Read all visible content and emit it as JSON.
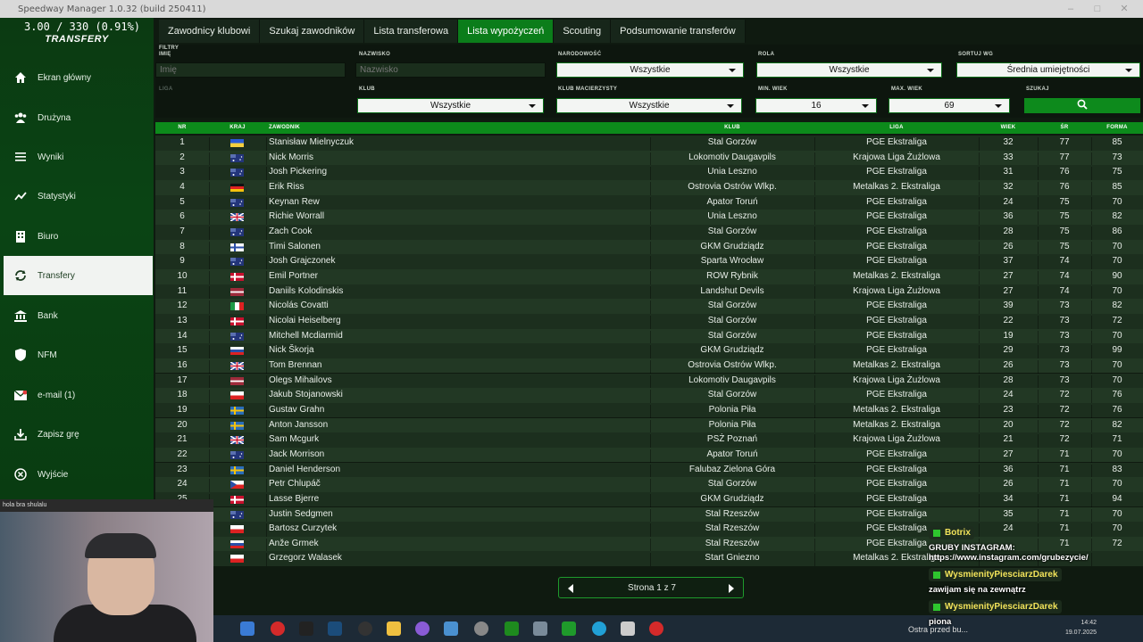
{
  "window": {
    "title": "Speedway Manager 1.0.32 (build 250411)"
  },
  "sidebar": {
    "budget": "3.00 / 330 (0.91%)",
    "section": "TRANSFERY",
    "items": [
      {
        "label": "Ekran główny",
        "icon": "home-icon"
      },
      {
        "label": "Drużyna",
        "icon": "team-icon"
      },
      {
        "label": "Wyniki",
        "icon": "list-icon"
      },
      {
        "label": "Statystyki",
        "icon": "stats-icon"
      },
      {
        "label": "Biuro",
        "icon": "office-icon"
      },
      {
        "label": "Transfery",
        "icon": "transfer-icon"
      },
      {
        "label": "Bank",
        "icon": "bank-icon"
      },
      {
        "label": "NFM",
        "icon": "shield-icon"
      },
      {
        "label": "e-mail (1)",
        "icon": "mail-icon"
      },
      {
        "label": "Zapisz grę",
        "icon": "save-icon"
      },
      {
        "label": "Wyjście",
        "icon": "exit-icon"
      }
    ],
    "active_index": 5
  },
  "tabs": [
    "Zawodnicy klubowi",
    "Szukaj zawodników",
    "Lista transferowa",
    "Lista wypożyczeń",
    "Scouting",
    "Podsumowanie transferów"
  ],
  "active_tab": 3,
  "filters": {
    "heading": "FILTRY",
    "name_label": "IMIĘ",
    "name_placeholder": "Imię",
    "surname_label": "NAZWISKO",
    "surname_placeholder": "Nazwisko",
    "nationality_label": "NARODOWOŚĆ",
    "nationality_value": "Wszystkie",
    "role_label": "ROLA",
    "role_value": "Wszystkie",
    "sort_label": "SORTUJ WG",
    "sort_value": "Średnia umiejętności",
    "league_label": "LIGA",
    "club_label": "KLUB",
    "club_value": "Wszystkie",
    "parent_club_label": "KLUB MACIERZYSTY",
    "parent_club_value": "Wszystkie",
    "min_age_label": "MIN. WIEK",
    "min_age_value": "16",
    "max_age_label": "MAX. WIEK",
    "max_age_value": "69",
    "search_label": "SZUKAJ"
  },
  "table": {
    "headers": {
      "nr": "NR",
      "kraj": "KRAJ",
      "zawodnik": "ZAWODNIK",
      "klub": "KLUB",
      "liga": "LIGA",
      "wiek": "WIEK",
      "sr": "ŚR",
      "forma": "FORMA"
    },
    "rows": [
      {
        "nr": "1",
        "flag": "ua",
        "name": "Stanisław Mielnyczuk",
        "club": "Stal Gorzów",
        "league": "PGE Ekstraliga",
        "age": "32",
        "avg": "77",
        "form": "85"
      },
      {
        "nr": "2",
        "flag": "au",
        "name": "Nick Morris",
        "club": "Lokomotiv Daugavpils",
        "league": "Krajowa Liga Żużlowa",
        "age": "33",
        "avg": "77",
        "form": "73"
      },
      {
        "nr": "3",
        "flag": "au",
        "name": "Josh Pickering",
        "club": "Unia Leszno",
        "league": "PGE Ekstraliga",
        "age": "31",
        "avg": "76",
        "form": "75"
      },
      {
        "nr": "4",
        "flag": "de",
        "name": "Erik Riss",
        "club": "Ostrovia Ostrów Wlkp.",
        "league": "Metalkas 2. Ekstraliga",
        "age": "32",
        "avg": "76",
        "form": "85"
      },
      {
        "nr": "5",
        "flag": "au",
        "name": "Keynan Rew",
        "club": "Apator Toruń",
        "league": "PGE Ekstraliga",
        "age": "24",
        "avg": "75",
        "form": "70"
      },
      {
        "nr": "6",
        "flag": "gb",
        "name": "Richie Worrall",
        "club": "Unia Leszno",
        "league": "PGE Ekstraliga",
        "age": "36",
        "avg": "75",
        "form": "82"
      },
      {
        "nr": "7",
        "flag": "au",
        "name": "Zach Cook",
        "club": "Stal Gorzów",
        "league": "PGE Ekstraliga",
        "age": "28",
        "avg": "75",
        "form": "86"
      },
      {
        "nr": "8",
        "flag": "fi",
        "name": "Timi Salonen",
        "club": "GKM Grudziądz",
        "league": "PGE Ekstraliga",
        "age": "26",
        "avg": "75",
        "form": "70"
      },
      {
        "nr": "9",
        "flag": "au",
        "name": "Josh Grajczonek",
        "club": "Sparta Wrocław",
        "league": "PGE Ekstraliga",
        "age": "37",
        "avg": "74",
        "form": "70"
      },
      {
        "nr": "10",
        "flag": "dk",
        "name": "Emil Portner",
        "club": "ROW Rybnik",
        "league": "Metalkas 2. Ekstraliga",
        "age": "27",
        "avg": "74",
        "form": "90"
      },
      {
        "nr": "11",
        "flag": "lv",
        "name": "Daniils Kolodinskis",
        "club": "Landshut Devils",
        "league": "Krajowa Liga Żużlowa",
        "age": "27",
        "avg": "74",
        "form": "70"
      },
      {
        "nr": "12",
        "flag": "it",
        "name": "Nicolás Covatti",
        "club": "Stal Gorzów",
        "league": "PGE Ekstraliga",
        "age": "39",
        "avg": "73",
        "form": "82"
      },
      {
        "nr": "13",
        "flag": "dk",
        "name": "Nicolai Heiselberg",
        "club": "Stal Gorzów",
        "league": "PGE Ekstraliga",
        "age": "22",
        "avg": "73",
        "form": "72"
      },
      {
        "nr": "14",
        "flag": "au",
        "name": "Mitchell Mcdiarmid",
        "club": "Stal Gorzów",
        "league": "PGE Ekstraliga",
        "age": "19",
        "avg": "73",
        "form": "70"
      },
      {
        "nr": "15",
        "flag": "si",
        "name": "Nick Škorja",
        "club": "GKM Grudziądz",
        "league": "PGE Ekstraliga",
        "age": "29",
        "avg": "73",
        "form": "99"
      },
      {
        "nr": "16",
        "flag": "gb",
        "name": "Tom Brennan",
        "club": "Ostrovia Ostrów Wlkp.",
        "league": "Metalkas 2. Ekstraliga",
        "age": "26",
        "avg": "73",
        "form": "70"
      },
      {
        "nr": "17",
        "flag": "lv",
        "name": "Olegs Mihailovs",
        "club": "Lokomotiv Daugavpils",
        "league": "Krajowa Liga Żużlowa",
        "age": "28",
        "avg": "73",
        "form": "70"
      },
      {
        "nr": "18",
        "flag": "pl",
        "name": "Jakub Stojanowski",
        "club": "Stal Gorzów",
        "league": "PGE Ekstraliga",
        "age": "24",
        "avg": "72",
        "form": "76"
      },
      {
        "nr": "19",
        "flag": "se",
        "name": "Gustav Grahn",
        "club": "Polonia Piła",
        "league": "Metalkas 2. Ekstraliga",
        "age": "23",
        "avg": "72",
        "form": "76"
      },
      {
        "nr": "20",
        "flag": "se",
        "name": "Anton Jansson",
        "club": "Polonia Piła",
        "league": "Metalkas 2. Ekstraliga",
        "age": "20",
        "avg": "72",
        "form": "82"
      },
      {
        "nr": "21",
        "flag": "gb",
        "name": "Sam Mcgurk",
        "club": "PSŻ Poznań",
        "league": "Krajowa Liga Żużlowa",
        "age": "21",
        "avg": "72",
        "form": "71"
      },
      {
        "nr": "22",
        "flag": "au",
        "name": "Jack Morrison",
        "club": "Apator Toruń",
        "league": "PGE Ekstraliga",
        "age": "27",
        "avg": "71",
        "form": "70"
      },
      {
        "nr": "23",
        "flag": "se",
        "name": "Daniel Henderson",
        "club": "Falubaz Zielona Góra",
        "league": "PGE Ekstraliga",
        "age": "36",
        "avg": "71",
        "form": "83"
      },
      {
        "nr": "24",
        "flag": "cz",
        "name": "Petr Chlupáč",
        "club": "Stal Gorzów",
        "league": "PGE Ekstraliga",
        "age": "26",
        "avg": "71",
        "form": "70"
      },
      {
        "nr": "25",
        "flag": "dk",
        "name": "Lasse Bjerre",
        "club": "GKM Grudziądz",
        "league": "PGE Ekstraliga",
        "age": "34",
        "avg": "71",
        "form": "94"
      },
      {
        "nr": "26",
        "flag": "au",
        "name": "Justin Sedgmen",
        "club": "Stal Rzeszów",
        "league": "PGE Ekstraliga",
        "age": "35",
        "avg": "71",
        "form": "70"
      },
      {
        "nr": "27",
        "flag": "pl",
        "name": "Bartosz Curzytek",
        "club": "Stal Rzeszów",
        "league": "PGE Ekstraliga",
        "age": "24",
        "avg": "71",
        "form": "70"
      },
      {
        "nr": "28",
        "flag": "si",
        "name": "Anže Grmek",
        "club": "Stal Rzeszów",
        "league": "PGE Ekstraliga",
        "age": "",
        "avg": "71",
        "form": "72"
      },
      {
        "nr": "29",
        "flag": "pl",
        "name": "Grzegorz Walasek",
        "club": "Start Gniezno",
        "league": "Metalkas 2. Ekstraliga",
        "age": "",
        "avg": "",
        "form": ""
      }
    ]
  },
  "pager": {
    "label": "Strona 1 z 7"
  },
  "chat": [
    {
      "user": "Botrix",
      "text": "GRUBY INSTAGRAM: https://www.instagram.com/grubezycie/"
    },
    {
      "user": "WysmienityPiesciarzDarek",
      "text": "zawijam się na zewnątrz"
    },
    {
      "user": "WysmienityPiesciarzDarek",
      "text": "piona"
    }
  ],
  "webcam": {
    "overlay_text": "hola bra shulalu"
  },
  "taskbar": {
    "tray_text": "Ostra przed bu...",
    "time": "14:42",
    "date": "19.07.2025"
  }
}
